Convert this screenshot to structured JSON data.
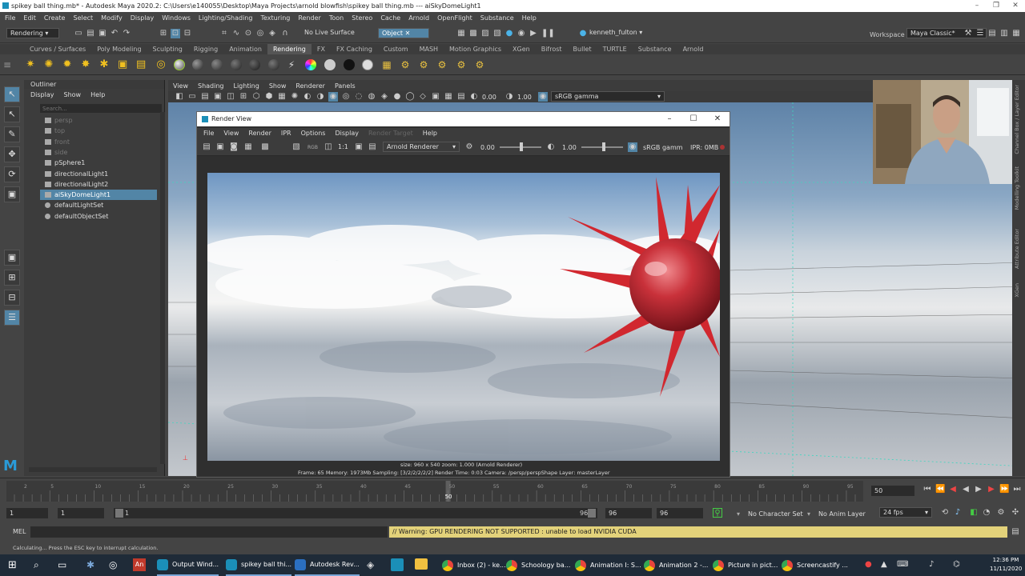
{
  "window": {
    "title": "spikey ball thing.mb* - Autodesk Maya 2020.2: C:\\Users\\e140055\\Desktop\\Maya Projects\\arnold blowfish\\spikey ball thing.mb  ---  aiSkyDomeLight1",
    "workspace_label": "Workspace :",
    "workspace_value": "Maya Classic*"
  },
  "menubar": [
    "File",
    "Edit",
    "Create",
    "Select",
    "Modify",
    "Display",
    "Windows",
    "Lighting/Shading",
    "Texturing",
    "Render",
    "Toon",
    "Stereo",
    "Cache",
    "Arnold",
    "OpenFlight",
    "Substance",
    "Help"
  ],
  "statusline": {
    "menuset": "Rendering",
    "live_surface": "No Live Surface",
    "object_field": "Object",
    "user": "kenneth_fulton"
  },
  "shelf_tabs": [
    {
      "label": "Curves / Surfaces",
      "active": false
    },
    {
      "label": "Poly Modeling",
      "active": false
    },
    {
      "label": "Sculpting",
      "active": false
    },
    {
      "label": "Rigging",
      "active": false
    },
    {
      "label": "Animation",
      "active": false
    },
    {
      "label": "Rendering",
      "active": true
    },
    {
      "label": "FX",
      "active": false
    },
    {
      "label": "FX Caching",
      "active": false
    },
    {
      "label": "Custom",
      "active": false
    },
    {
      "label": "MASH",
      "active": false
    },
    {
      "label": "Motion Graphics",
      "active": false
    },
    {
      "label": "XGen",
      "active": false
    },
    {
      "label": "Bifrost",
      "active": false
    },
    {
      "label": "Bullet",
      "active": false
    },
    {
      "label": "TURTLE",
      "active": false
    },
    {
      "label": "Substance",
      "active": false
    },
    {
      "label": "Arnold",
      "active": false
    }
  ],
  "outliner": {
    "header": "Outliner",
    "menu": [
      "Display",
      "Show",
      "Help"
    ],
    "search_placeholder": "Search...",
    "items": [
      {
        "label": "persp",
        "dim": true,
        "selected": false
      },
      {
        "label": "top",
        "dim": true,
        "selected": false
      },
      {
        "label": "front",
        "dim": true,
        "selected": false
      },
      {
        "label": "side",
        "dim": true,
        "selected": false
      },
      {
        "label": "pSphere1",
        "dim": false,
        "selected": false
      },
      {
        "label": "directionalLight1",
        "dim": false,
        "selected": false
      },
      {
        "label": "directionalLight2",
        "dim": false,
        "selected": false
      },
      {
        "label": "aiSkyDomeLight1",
        "dim": false,
        "selected": true
      },
      {
        "label": "defaultLightSet",
        "dim": false,
        "selected": false
      },
      {
        "label": "defaultObjectSet",
        "dim": false,
        "selected": false
      }
    ]
  },
  "viewport": {
    "menu": [
      "View",
      "Shading",
      "Lighting",
      "Show",
      "Renderer",
      "Panels"
    ],
    "val1": "0.00",
    "val2": "1.00",
    "colorspace": "sRGB gamma"
  },
  "render_view": {
    "title": "Render View",
    "menu": [
      {
        "label": "File",
        "disabled": false
      },
      {
        "label": "View",
        "disabled": false
      },
      {
        "label": "Render",
        "disabled": false
      },
      {
        "label": "IPR",
        "disabled": false
      },
      {
        "label": "Options",
        "disabled": false
      },
      {
        "label": "Display",
        "disabled": false
      },
      {
        "label": "Render Target",
        "disabled": true
      },
      {
        "label": "Help",
        "disabled": false
      }
    ],
    "ratio": "1:1",
    "renderer": "Arnold Renderer",
    "exposure": "0.00",
    "gamma": "1.00",
    "colorspace": "sRGB gamm",
    "ipr": "IPR: 0MB",
    "info_line1": "size: 960 x 540  zoom: 1.000     (Arnold Renderer)",
    "info_line2": "Frame: 65     Memory: 1973Mb     Sampling: [3/2/2/2/2/2]     Render Time: 0:03     Camera: /persp/perspShape     Layer: masterLayer"
  },
  "right_tabs": [
    "Channel Box / Layer Editor",
    "Modelling Toolkit",
    "Attribute Editor",
    "XGen"
  ],
  "timeline": {
    "ticks": [
      "2",
      "5",
      "10",
      "15",
      "20",
      "25",
      "30",
      "35",
      "40",
      "45",
      "50",
      "55",
      "60",
      "65",
      "70",
      "75",
      "80",
      "85",
      "90",
      "95"
    ],
    "current_frame_marker": "50",
    "current_frame": "50",
    "range_start": "1",
    "playback_start": "1",
    "slider_start": "1",
    "slider_end": "96",
    "playback_end": "96",
    "range_end": "96",
    "character_set": "No Character Set",
    "anim_layer": "No Anim Layer",
    "fps": "24 fps"
  },
  "cmdline": {
    "label": "MEL",
    "warning": "// Warning: GPU RENDERING NOT SUPPORTED : unable to load NVIDIA CUDA"
  },
  "helpline": "Calculating...  Press the ESC key to interrupt calculation.",
  "taskbar": {
    "apps": [
      {
        "label": "Output Wind...",
        "color": "#1b8fb8"
      },
      {
        "label": "spikey ball thi...",
        "color": "#1b8fb8"
      },
      {
        "label": "Autodesk Rev...",
        "color": "#2b6fc0"
      },
      {
        "label": "Inbox (2) - ke...",
        "color": "#e8453c"
      },
      {
        "label": "Schoology ba...",
        "color": "#e8453c"
      },
      {
        "label": "Animation I: S...",
        "color": "#e8453c"
      },
      {
        "label": "Animation 2 -...",
        "color": "#e8453c"
      },
      {
        "label": "Picture in pict...",
        "color": "#e8453c"
      },
      {
        "label": "Screencastify ...",
        "color": "#e8453c"
      }
    ],
    "time": "12:36 PM",
    "date": "11/11/2020"
  }
}
